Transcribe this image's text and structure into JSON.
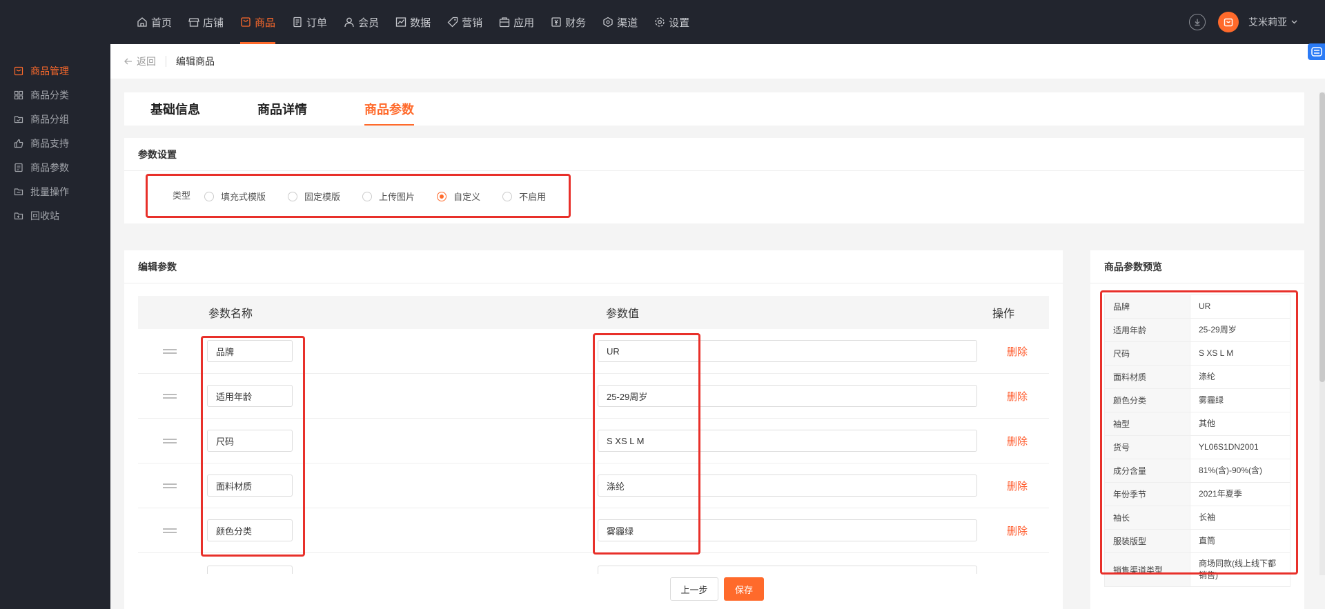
{
  "topnav": {
    "items": [
      {
        "label": "首页",
        "icon": "home-icon"
      },
      {
        "label": "店铺",
        "icon": "shop-icon"
      },
      {
        "label": "商品",
        "icon": "goods-icon",
        "active": true
      },
      {
        "label": "订单",
        "icon": "order-icon"
      },
      {
        "label": "会员",
        "icon": "member-icon"
      },
      {
        "label": "数据",
        "icon": "chart-icon"
      },
      {
        "label": "营销",
        "icon": "tag-icon"
      },
      {
        "label": "应用",
        "icon": "app-icon"
      },
      {
        "label": "财务",
        "icon": "finance-icon"
      },
      {
        "label": "渠道",
        "icon": "channel-icon"
      },
      {
        "label": "设置",
        "icon": "gear-icon"
      }
    ],
    "username": "艾米莉亚"
  },
  "sidebar": {
    "items": [
      {
        "label": "商品管理",
        "active": true
      },
      {
        "label": "商品分类"
      },
      {
        "label": "商品分组"
      },
      {
        "label": "商品支持"
      },
      {
        "label": "商品参数"
      },
      {
        "label": "批量操作"
      },
      {
        "label": "回收站"
      }
    ]
  },
  "breadcrumb": {
    "back": "返回",
    "title": "编辑商品"
  },
  "tabs": [
    {
      "label": "基础信息"
    },
    {
      "label": "商品详情"
    },
    {
      "label": "商品参数",
      "active": true
    }
  ],
  "param_settings": {
    "title": "参数设置",
    "type_label": "类型",
    "options": [
      "填充式模版",
      "固定模版",
      "上传图片",
      "自定义",
      "不启用"
    ],
    "selected": "自定义"
  },
  "edit_params": {
    "title": "编辑参数",
    "columns": {
      "name": "参数名称",
      "value": "参数值",
      "action": "操作"
    },
    "delete_label": "删除",
    "rows": [
      {
        "name": "品牌",
        "value": "UR"
      },
      {
        "name": "适用年龄",
        "value": "25-29周岁"
      },
      {
        "name": "尺码",
        "value": "S XS L M"
      },
      {
        "name": "面料材质",
        "value": "涤纶"
      },
      {
        "name": "颜色分类",
        "value": "雾霾绿"
      }
    ]
  },
  "preview": {
    "title": "商品参数预览",
    "rows": [
      {
        "k": "品牌",
        "v": "UR"
      },
      {
        "k": "适用年龄",
        "v": "25-29周岁"
      },
      {
        "k": "尺码",
        "v": "S XS L M"
      },
      {
        "k": "面料材质",
        "v": "涤纶"
      },
      {
        "k": "颜色分类",
        "v": "雾霾绿"
      },
      {
        "k": "袖型",
        "v": "其他"
      },
      {
        "k": "货号",
        "v": "YL06S1DN2001"
      },
      {
        "k": "成分含量",
        "v": "81%(含)-90%(含)"
      },
      {
        "k": "年份季节",
        "v": "2021年夏季"
      },
      {
        "k": "袖长",
        "v": "长袖"
      },
      {
        "k": "服装版型",
        "v": "直筒"
      },
      {
        "k": "销售渠道类型",
        "v": "商场同款(线上线下都销售)"
      }
    ]
  },
  "footer": {
    "prev": "上一步",
    "save": "保存"
  },
  "colors": {
    "accent": "#ff6a2b",
    "nav_bg": "#22252e",
    "highlight": "#e8302a"
  }
}
